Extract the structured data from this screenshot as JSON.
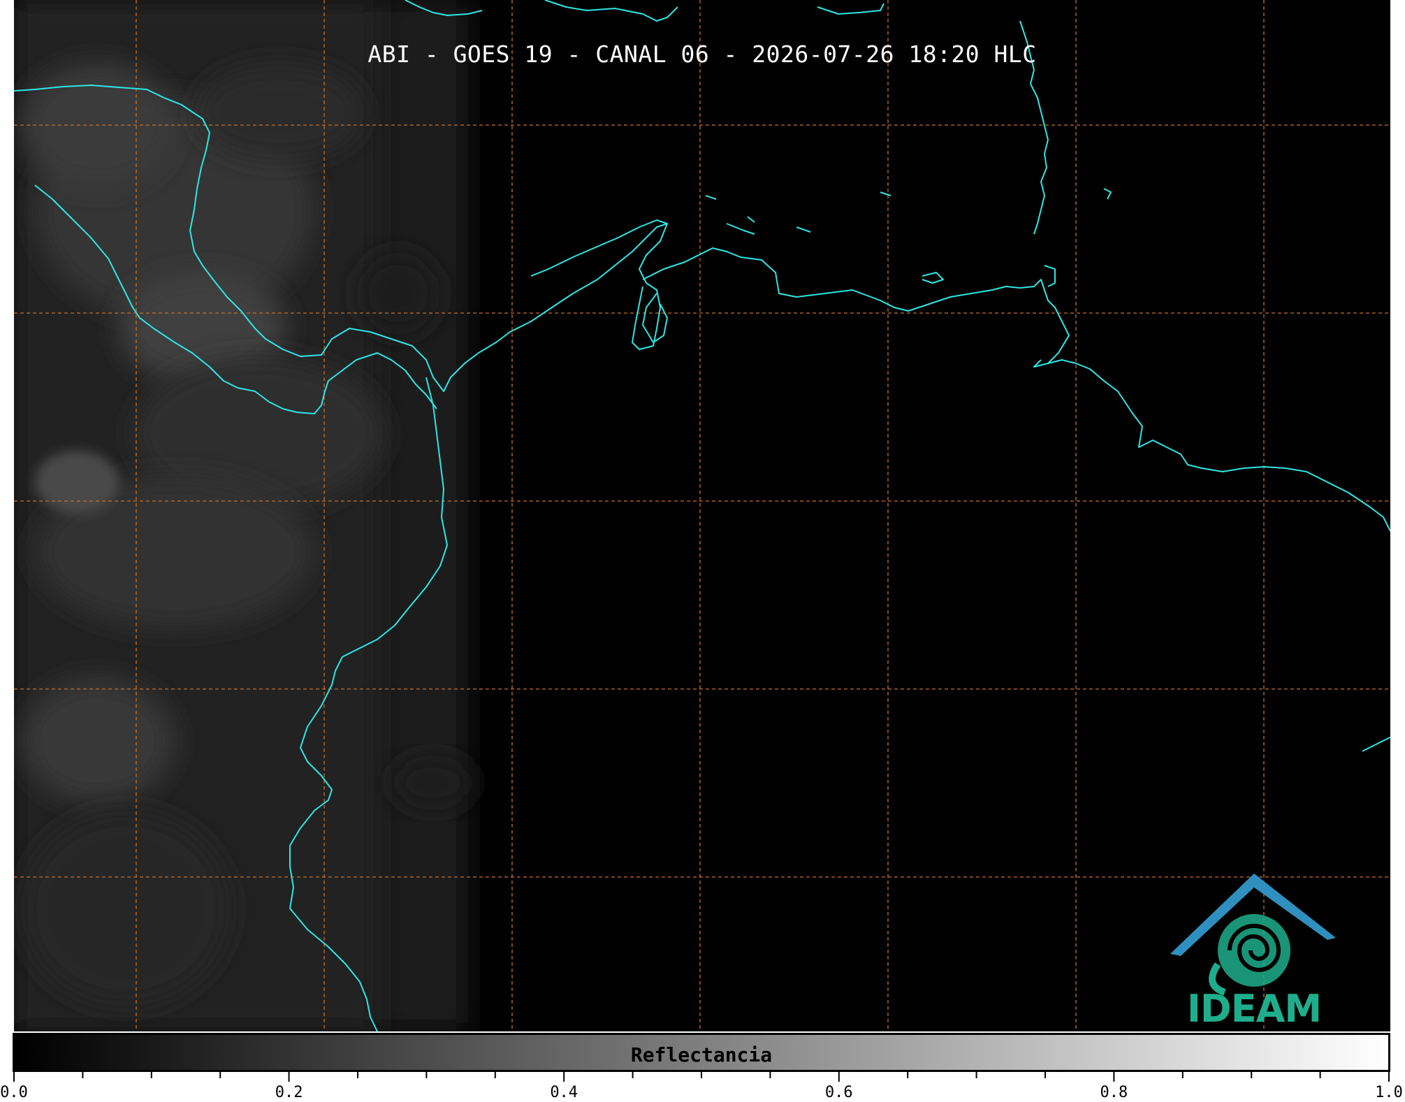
{
  "title": "ABI - GOES 19 - CANAL 06 - 2026-07-26 18:20 HLC",
  "colors": {
    "coastline": "#2ee6e6",
    "graticule": "#c8702a",
    "background": "#000000",
    "logo_text": "#1fae8c",
    "logo_roof": "#2f8fbf"
  },
  "map": {
    "graticule_style": "dashed",
    "coastlines": true
  },
  "colorbar": {
    "label": "Reflectancia",
    "min": 0.0,
    "max": 1.0,
    "colormap": "gray",
    "tick_labels": [
      "0.0",
      "0.2",
      "0.4",
      "0.6",
      "0.8",
      "1.0"
    ],
    "major_ticks": [
      0.0,
      0.2,
      0.4,
      0.6,
      0.8,
      1.0
    ],
    "minor_step": 0.05
  },
  "logo": {
    "text": "IDEAM",
    "icon": "ideam-spiral-roof-logo"
  }
}
